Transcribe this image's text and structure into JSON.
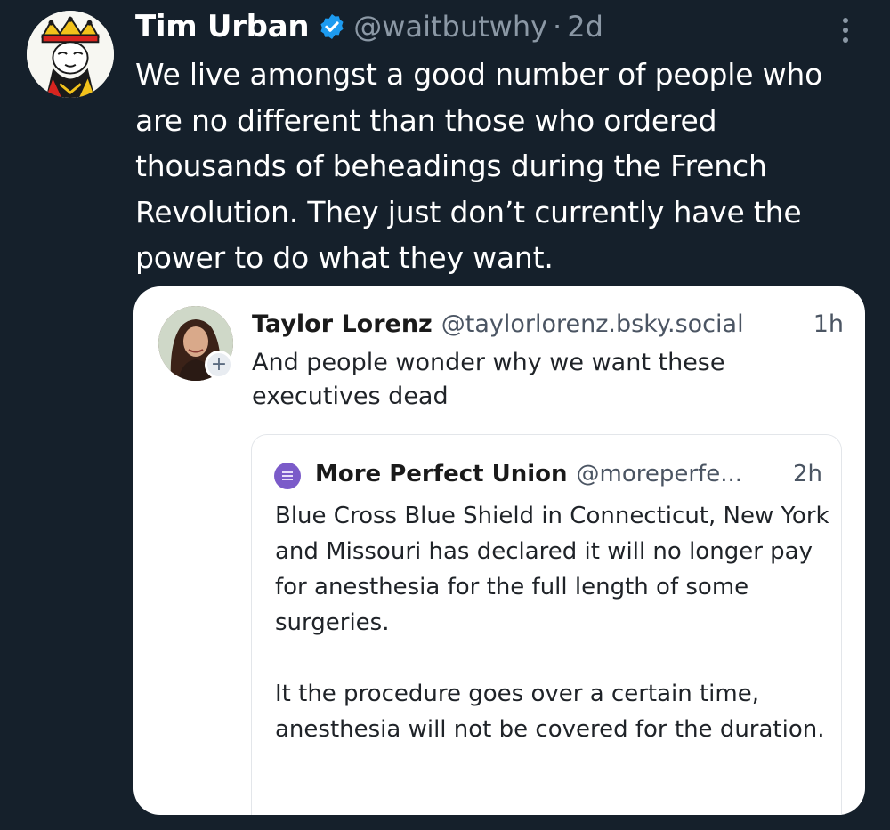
{
  "tweet": {
    "author_name": "Tim Urban",
    "handle": "@waitbutwhy",
    "separator": "·",
    "time": "2d",
    "text": "We live amongst a good number of people who are no different than those who ordered thousands of beheadings during the French Revolution. They just don’t currently have the power to do what they want.",
    "avatar_icon": "king-of-spades-icon",
    "verified_icon": "verified-badge-icon",
    "more_icon": "more-vertical-icon"
  },
  "quoted_post": {
    "author_name": "Taylor Lorenz",
    "handle": "@taylorlorenz.bsky.social",
    "time": "1h",
    "text": "And people wonder why we want these executives dead",
    "follow_badge": "+"
  },
  "nested_post": {
    "author_name": "More Perfect Union",
    "handle": "@moreperfe...",
    "time": "2h",
    "paragraph_1": "Blue Cross Blue Shield in Connecticut, New York and Missouri has declared it will no longer pay for anesthesia for the full length of some surgeries.",
    "paragraph_2": "It the procedure goes over a certain time, anesthesia will not be covered for the duration."
  },
  "colors": {
    "background": "#15202b",
    "verified_blue": "#1d9bf0",
    "muted_text": "#8b98a5",
    "card_background": "#ffffff"
  }
}
